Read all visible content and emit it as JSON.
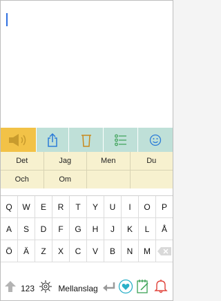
{
  "toolbar": {
    "buttons": [
      {
        "icon": "speaker-icon",
        "bg": "#f2c247"
      },
      {
        "icon": "share-icon",
        "bg": "#bfe0d8"
      },
      {
        "icon": "trash-icon",
        "bg": "#bfe0d8"
      },
      {
        "icon": "list-icon",
        "bg": "#bfe0d8"
      },
      {
        "icon": "smiley-icon",
        "bg": "#bfe0d8"
      }
    ]
  },
  "suggestions": {
    "row1": [
      "Det",
      "Jag",
      "Men",
      "Du"
    ],
    "row2": [
      "Och",
      "Om",
      "",
      ""
    ]
  },
  "keyboard": {
    "row1": [
      "Q",
      "W",
      "E",
      "R",
      "T",
      "Y",
      "U",
      "I",
      "O",
      "P"
    ],
    "row2": [
      "A",
      "S",
      "D",
      "F",
      "G",
      "H",
      "J",
      "K",
      "L",
      "Å"
    ],
    "row3": [
      "Ö",
      "Ä",
      "Z",
      "X",
      "C",
      "V",
      "B",
      "N",
      "M"
    ],
    "bottom": {
      "numbers_label": "123",
      "space_label": "Mellanslag"
    }
  }
}
